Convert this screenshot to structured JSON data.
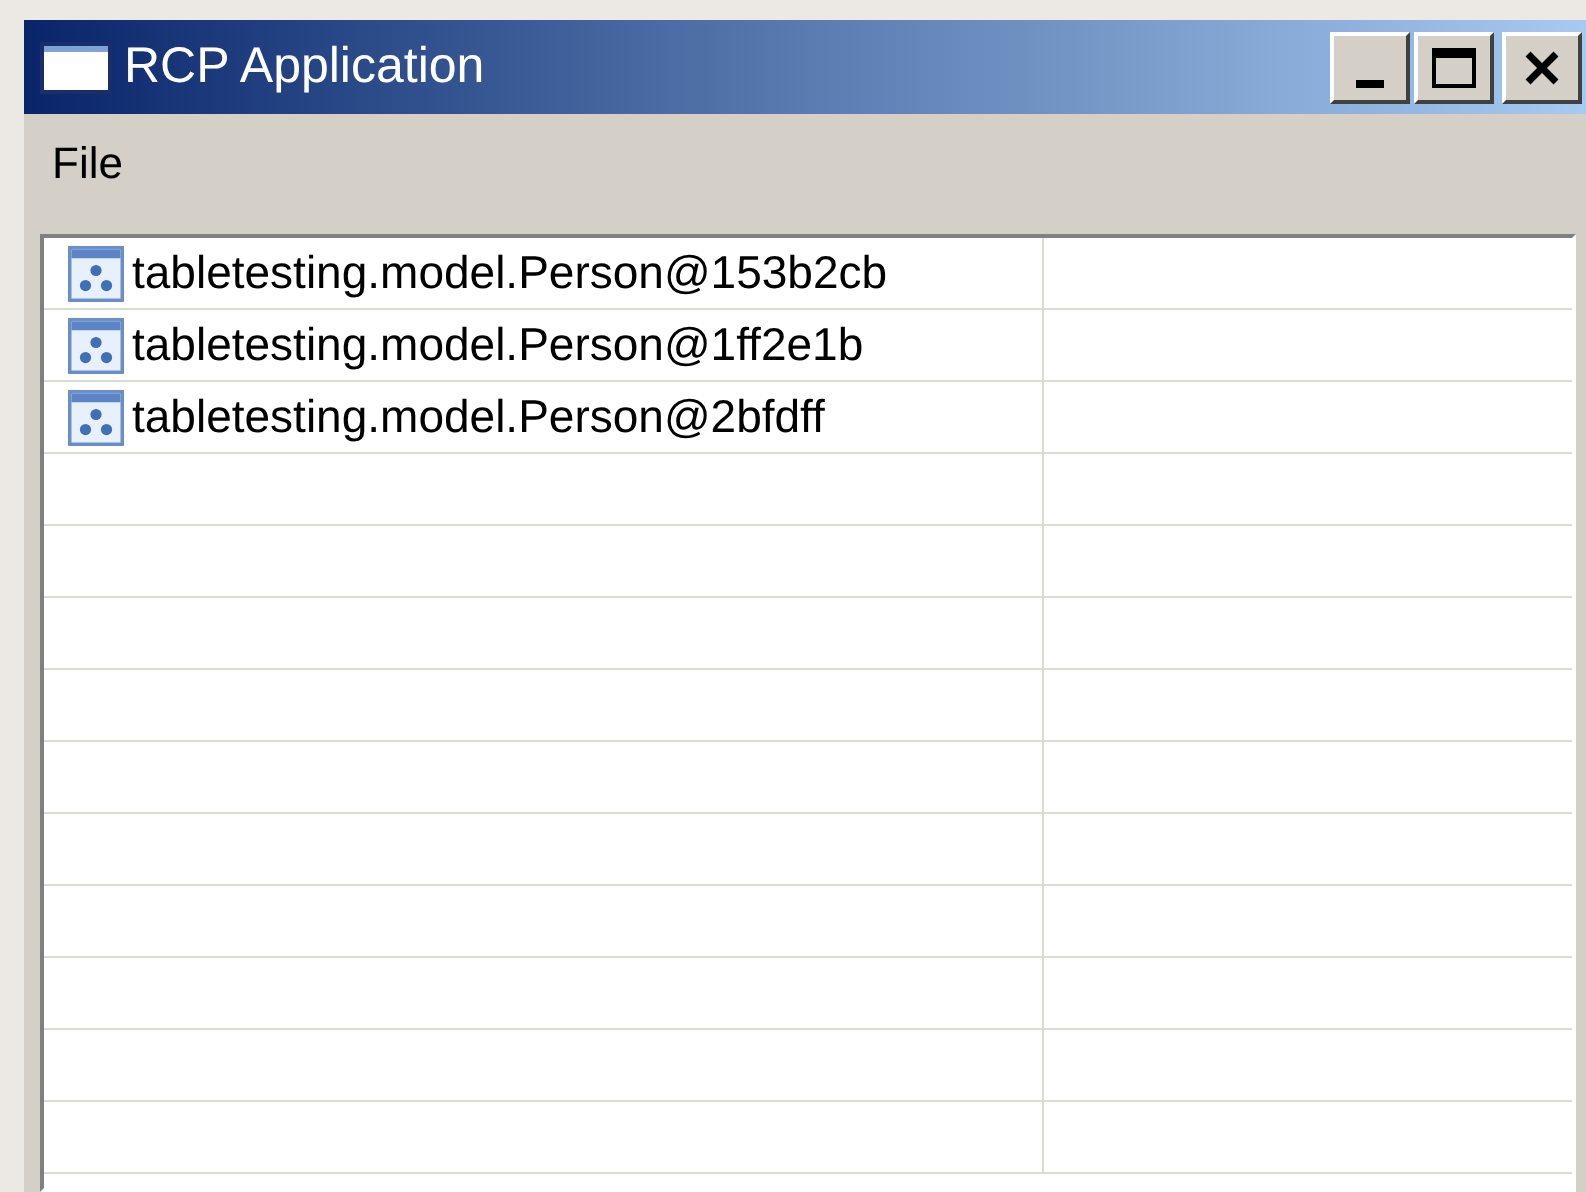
{
  "window": {
    "title": "RCP Application"
  },
  "menu": [
    "File"
  ],
  "table": {
    "rows": [
      {
        "text": "tabletesting.model.Person@153b2cb"
      },
      {
        "text": "tabletesting.model.Person@1ff2e1b"
      },
      {
        "text": "tabletesting.model.Person@2bfdff"
      }
    ]
  }
}
